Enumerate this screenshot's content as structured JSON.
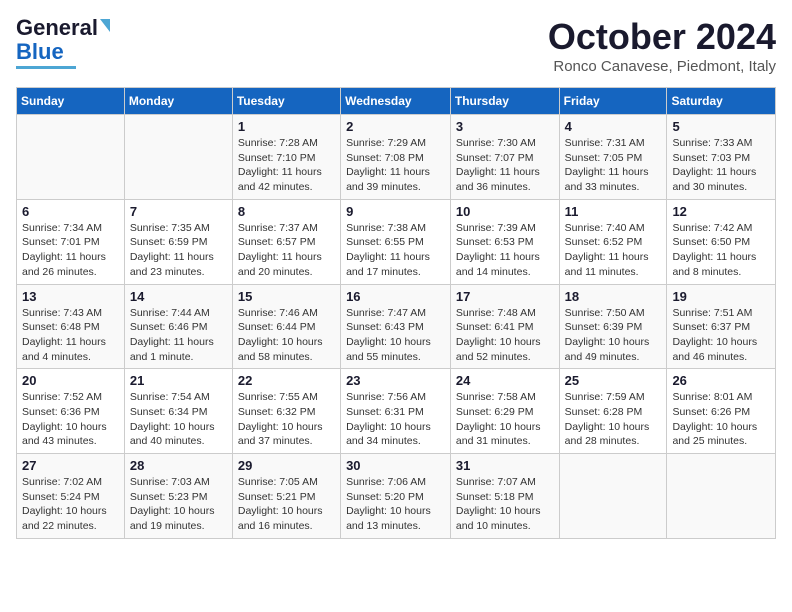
{
  "logo": {
    "line1": "General",
    "line2": "Blue"
  },
  "header": {
    "month": "October 2024",
    "location": "Ronco Canavese, Piedmont, Italy"
  },
  "days_of_week": [
    "Sunday",
    "Monday",
    "Tuesday",
    "Wednesday",
    "Thursday",
    "Friday",
    "Saturday"
  ],
  "weeks": [
    [
      {
        "day": "",
        "info": ""
      },
      {
        "day": "",
        "info": ""
      },
      {
        "day": "1",
        "info": "Sunrise: 7:28 AM\nSunset: 7:10 PM\nDaylight: 11 hours and 42 minutes."
      },
      {
        "day": "2",
        "info": "Sunrise: 7:29 AM\nSunset: 7:08 PM\nDaylight: 11 hours and 39 minutes."
      },
      {
        "day": "3",
        "info": "Sunrise: 7:30 AM\nSunset: 7:07 PM\nDaylight: 11 hours and 36 minutes."
      },
      {
        "day": "4",
        "info": "Sunrise: 7:31 AM\nSunset: 7:05 PM\nDaylight: 11 hours and 33 minutes."
      },
      {
        "day": "5",
        "info": "Sunrise: 7:33 AM\nSunset: 7:03 PM\nDaylight: 11 hours and 30 minutes."
      }
    ],
    [
      {
        "day": "6",
        "info": "Sunrise: 7:34 AM\nSunset: 7:01 PM\nDaylight: 11 hours and 26 minutes."
      },
      {
        "day": "7",
        "info": "Sunrise: 7:35 AM\nSunset: 6:59 PM\nDaylight: 11 hours and 23 minutes."
      },
      {
        "day": "8",
        "info": "Sunrise: 7:37 AM\nSunset: 6:57 PM\nDaylight: 11 hours and 20 minutes."
      },
      {
        "day": "9",
        "info": "Sunrise: 7:38 AM\nSunset: 6:55 PM\nDaylight: 11 hours and 17 minutes."
      },
      {
        "day": "10",
        "info": "Sunrise: 7:39 AM\nSunset: 6:53 PM\nDaylight: 11 hours and 14 minutes."
      },
      {
        "day": "11",
        "info": "Sunrise: 7:40 AM\nSunset: 6:52 PM\nDaylight: 11 hours and 11 minutes."
      },
      {
        "day": "12",
        "info": "Sunrise: 7:42 AM\nSunset: 6:50 PM\nDaylight: 11 hours and 8 minutes."
      }
    ],
    [
      {
        "day": "13",
        "info": "Sunrise: 7:43 AM\nSunset: 6:48 PM\nDaylight: 11 hours and 4 minutes."
      },
      {
        "day": "14",
        "info": "Sunrise: 7:44 AM\nSunset: 6:46 PM\nDaylight: 11 hours and 1 minute."
      },
      {
        "day": "15",
        "info": "Sunrise: 7:46 AM\nSunset: 6:44 PM\nDaylight: 10 hours and 58 minutes."
      },
      {
        "day": "16",
        "info": "Sunrise: 7:47 AM\nSunset: 6:43 PM\nDaylight: 10 hours and 55 minutes."
      },
      {
        "day": "17",
        "info": "Sunrise: 7:48 AM\nSunset: 6:41 PM\nDaylight: 10 hours and 52 minutes."
      },
      {
        "day": "18",
        "info": "Sunrise: 7:50 AM\nSunset: 6:39 PM\nDaylight: 10 hours and 49 minutes."
      },
      {
        "day": "19",
        "info": "Sunrise: 7:51 AM\nSunset: 6:37 PM\nDaylight: 10 hours and 46 minutes."
      }
    ],
    [
      {
        "day": "20",
        "info": "Sunrise: 7:52 AM\nSunset: 6:36 PM\nDaylight: 10 hours and 43 minutes."
      },
      {
        "day": "21",
        "info": "Sunrise: 7:54 AM\nSunset: 6:34 PM\nDaylight: 10 hours and 40 minutes."
      },
      {
        "day": "22",
        "info": "Sunrise: 7:55 AM\nSunset: 6:32 PM\nDaylight: 10 hours and 37 minutes."
      },
      {
        "day": "23",
        "info": "Sunrise: 7:56 AM\nSunset: 6:31 PM\nDaylight: 10 hours and 34 minutes."
      },
      {
        "day": "24",
        "info": "Sunrise: 7:58 AM\nSunset: 6:29 PM\nDaylight: 10 hours and 31 minutes."
      },
      {
        "day": "25",
        "info": "Sunrise: 7:59 AM\nSunset: 6:28 PM\nDaylight: 10 hours and 28 minutes."
      },
      {
        "day": "26",
        "info": "Sunrise: 8:01 AM\nSunset: 6:26 PM\nDaylight: 10 hours and 25 minutes."
      }
    ],
    [
      {
        "day": "27",
        "info": "Sunrise: 7:02 AM\nSunset: 5:24 PM\nDaylight: 10 hours and 22 minutes."
      },
      {
        "day": "28",
        "info": "Sunrise: 7:03 AM\nSunset: 5:23 PM\nDaylight: 10 hours and 19 minutes."
      },
      {
        "day": "29",
        "info": "Sunrise: 7:05 AM\nSunset: 5:21 PM\nDaylight: 10 hours and 16 minutes."
      },
      {
        "day": "30",
        "info": "Sunrise: 7:06 AM\nSunset: 5:20 PM\nDaylight: 10 hours and 13 minutes."
      },
      {
        "day": "31",
        "info": "Sunrise: 7:07 AM\nSunset: 5:18 PM\nDaylight: 10 hours and 10 minutes."
      },
      {
        "day": "",
        "info": ""
      },
      {
        "day": "",
        "info": ""
      }
    ]
  ]
}
